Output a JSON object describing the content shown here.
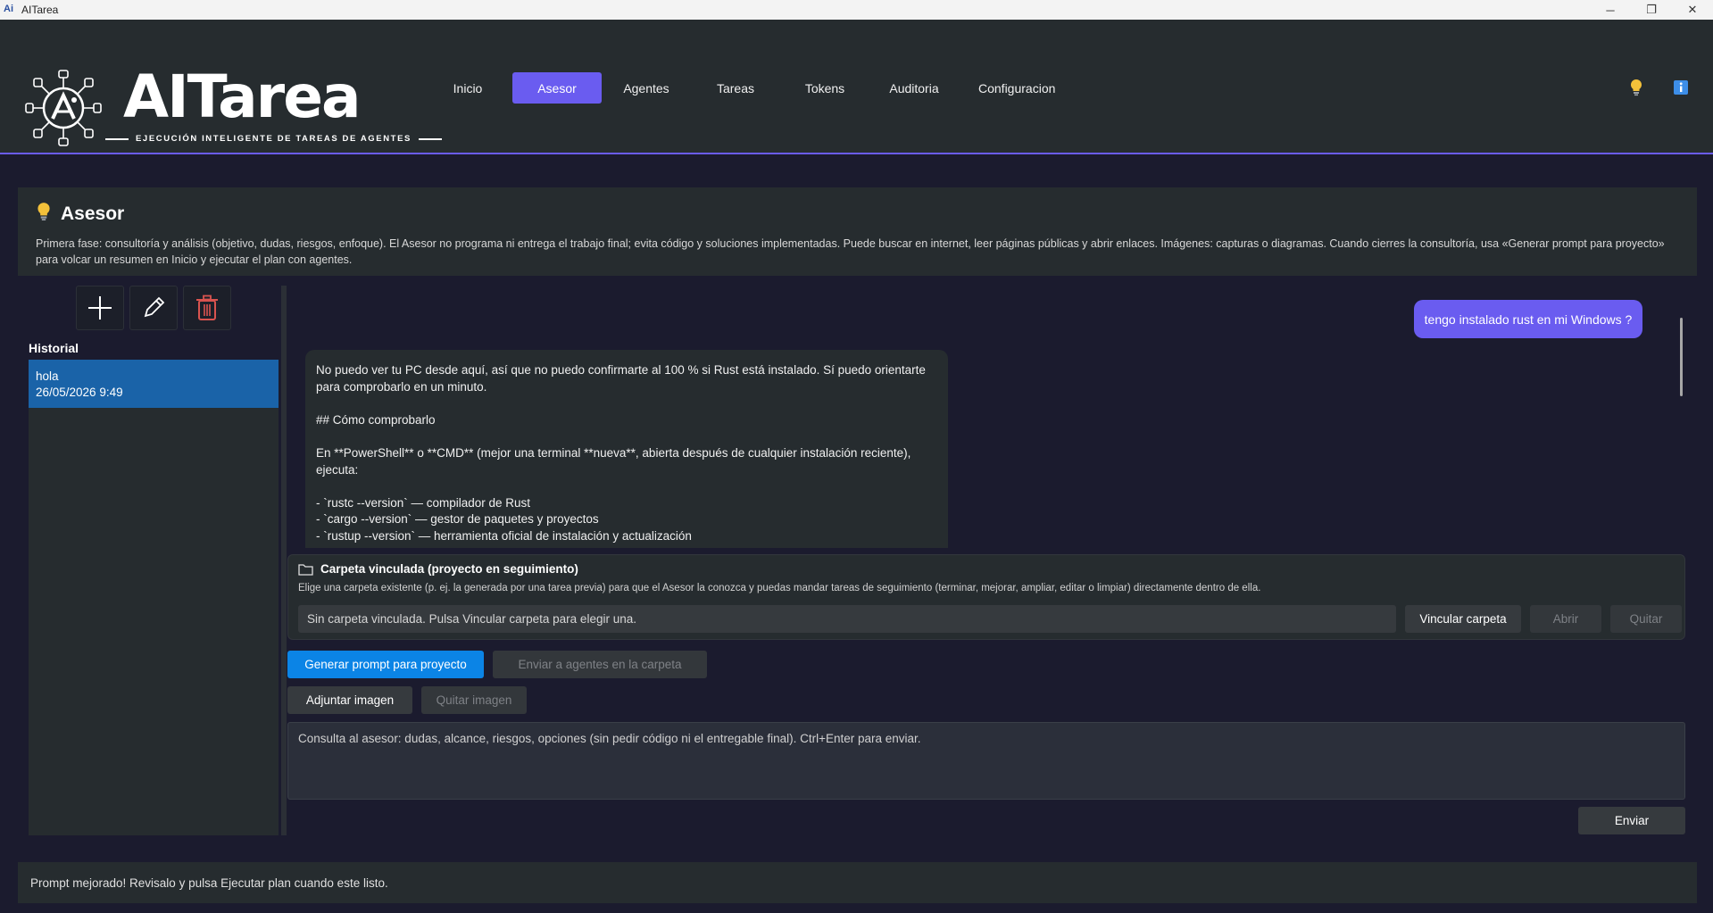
{
  "window": {
    "title": "AITarea",
    "controls": {
      "minimize": "─",
      "restore": "❐",
      "close": "✕"
    }
  },
  "logo": {
    "name": "AITarea",
    "tagline": "EJECUCIÓN INTELIGENTE DE TAREAS DE AGENTES"
  },
  "nav": {
    "items": [
      {
        "label": "Inicio",
        "active": false
      },
      {
        "label": "Asesor",
        "active": true
      },
      {
        "label": "Agentes",
        "active": false
      },
      {
        "label": "Tareas",
        "active": false
      },
      {
        "label": "Tokens",
        "active": false
      },
      {
        "label": "Auditoria",
        "active": false
      },
      {
        "label": "Configuracion",
        "active": false
      }
    ],
    "icons": [
      "lightbulb-icon",
      "info-icon"
    ]
  },
  "asesor": {
    "title": "Asesor",
    "description": "Primera fase: consultoría y análisis (objetivo, dudas, riesgos, enfoque). El Asesor no programa ni entrega el trabajo final; evita código y soluciones implementadas. Puede buscar en internet, leer páginas públicas y abrir enlaces. Imágenes: capturas o diagramas. Cuando cierres la consultoría, usa «Generar prompt para proyecto» para volcar un resumen en Inicio y ejecutar el plan con agentes."
  },
  "sidebar": {
    "history_label": "Historial",
    "items": [
      {
        "title": "hola",
        "date": "26/05/2026 9:49",
        "selected": true
      }
    ]
  },
  "chat": {
    "messages": [
      {
        "role": "user",
        "text": "tengo instalado rust en mi Windows ?"
      },
      {
        "role": "assistant",
        "lines": [
          "No puedo ver tu PC desde aquí, así que no puedo confirmarte al 100 % si Rust está instalado. Sí puedo orientarte para comprobarlo en un minuto.",
          "",
          "## Cómo comprobarlo",
          "",
          "En **PowerShell** o **CMD** (mejor una terminal **nueva**, abierta después de cualquier instalación reciente), ejecuta:",
          "",
          "- `rustc --version` — compilador de Rust",
          "- `cargo --version` — gestor de paquetes y proyectos",
          "- `rustup --version` — herramienta oficial de instalación y actualización"
        ]
      }
    ]
  },
  "folder": {
    "title": "Carpeta vinculada (proyecto en seguimiento)",
    "description": "Elige una carpeta existente (p. ej. la generada por una tarea previa) para que el Asesor la conozca y puedas mandar tareas de seguimiento (terminar, mejorar, ampliar, editar o limpiar) directamente dentro de ella.",
    "status": "Sin carpeta vinculada. Pulsa Vincular carpeta para elegir una.",
    "link_label": "Vincular carpeta",
    "open_label": "Abrir",
    "remove_label": "Quitar"
  },
  "actions": {
    "generate_prompt": "Generar prompt para proyecto",
    "send_to_agents": "Enviar a agentes en la carpeta",
    "attach_image": "Adjuntar imagen",
    "remove_image": "Quitar imagen"
  },
  "compose": {
    "placeholder": "Consulta al asesor: dudas, alcance, riesgos, opciones (sin pedir código ni el entregable final). Ctrl+Enter para enviar.",
    "send_label": "Enviar"
  },
  "status": {
    "message": "Prompt mejorado! Revisalo y pulsa Ejecutar plan cuando este listo."
  },
  "colors": {
    "accent": "#6a5cf0",
    "primary_button": "#0b84e6",
    "selected_item": "#1a63a8",
    "panel": "#262c2f",
    "background": "#1b1b2e",
    "delete_icon": "#d9534f"
  }
}
